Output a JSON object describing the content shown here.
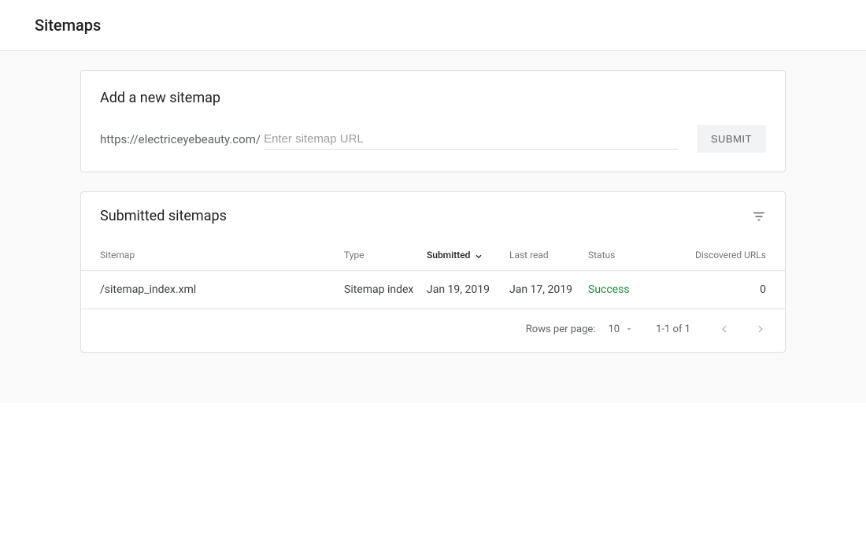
{
  "page": {
    "title": "Sitemaps"
  },
  "addCard": {
    "title": "Add a new sitemap",
    "urlPrefix": "https://electriceyebeauty.com/",
    "placeholder": "Enter sitemap URL",
    "submitLabel": "SUBMIT"
  },
  "tableCard": {
    "title": "Submitted sitemaps",
    "columns": {
      "sitemap": "Sitemap",
      "type": "Type",
      "submitted": "Submitted",
      "lastRead": "Last read",
      "status": "Status",
      "urls": "Discovered URLs"
    },
    "rows": [
      {
        "sitemap": "/sitemap_index.xml",
        "type": "Sitemap index",
        "submitted": "Jan 19, 2019",
        "lastRead": "Jan 17, 2019",
        "status": "Success",
        "urls": "0"
      }
    ],
    "footer": {
      "rowsPerPageLabel": "Rows per page:",
      "rowsPerPageValue": "10",
      "range": "1-1 of 1"
    }
  }
}
